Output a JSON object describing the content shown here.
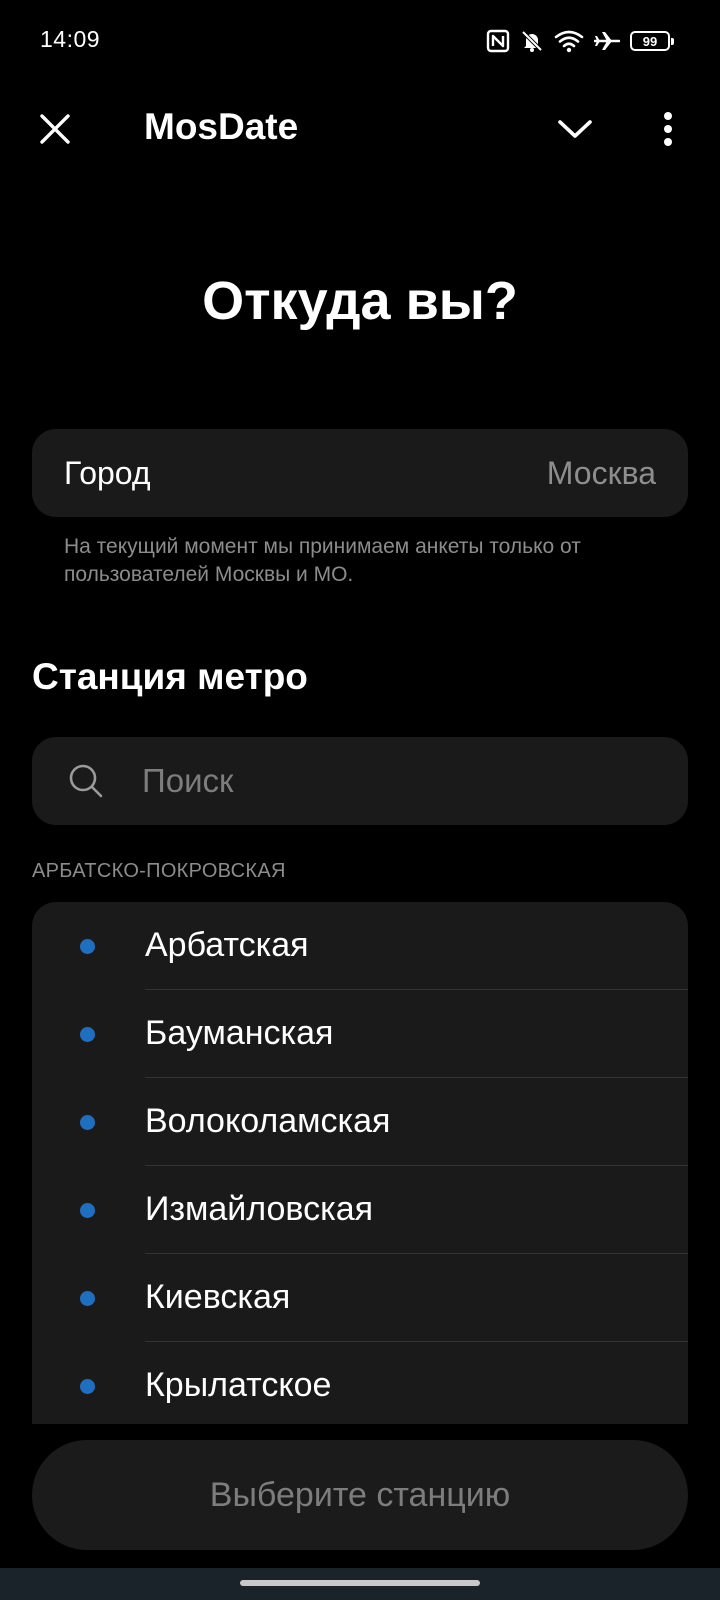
{
  "status_bar": {
    "time": "14:09",
    "battery": "99",
    "icons": [
      "nfc-icon",
      "bell-off-icon",
      "wifi-icon",
      "airplane-icon",
      "battery-icon"
    ]
  },
  "app_bar": {
    "title": "MosDate",
    "icons": [
      "close-icon",
      "chevron-down-icon",
      "more-vertical-icon"
    ]
  },
  "page": {
    "heading": "Откуда вы?"
  },
  "city": {
    "label": "Город",
    "value": "Москва",
    "note": "На текущий момент мы принимаем анкеты только от пользователей Москвы и МО."
  },
  "metro": {
    "heading": "Станция метро",
    "search": {
      "placeholder": "Поиск"
    },
    "line_name": "АРБАТСКО-ПОКРОВСКАЯ",
    "line_color": "#1e6fc0",
    "stations": [
      {
        "name": "Арбатская"
      },
      {
        "name": "Бауманская"
      },
      {
        "name": "Волоколамская"
      },
      {
        "name": "Измайловская"
      },
      {
        "name": "Киевская"
      },
      {
        "name": "Крылатское"
      }
    ]
  },
  "footer": {
    "select_button": "Выберите станцию"
  },
  "colors": {
    "background": "#000000",
    "surface": "#1a1a1a",
    "muted_text": "#8e8e8e"
  }
}
